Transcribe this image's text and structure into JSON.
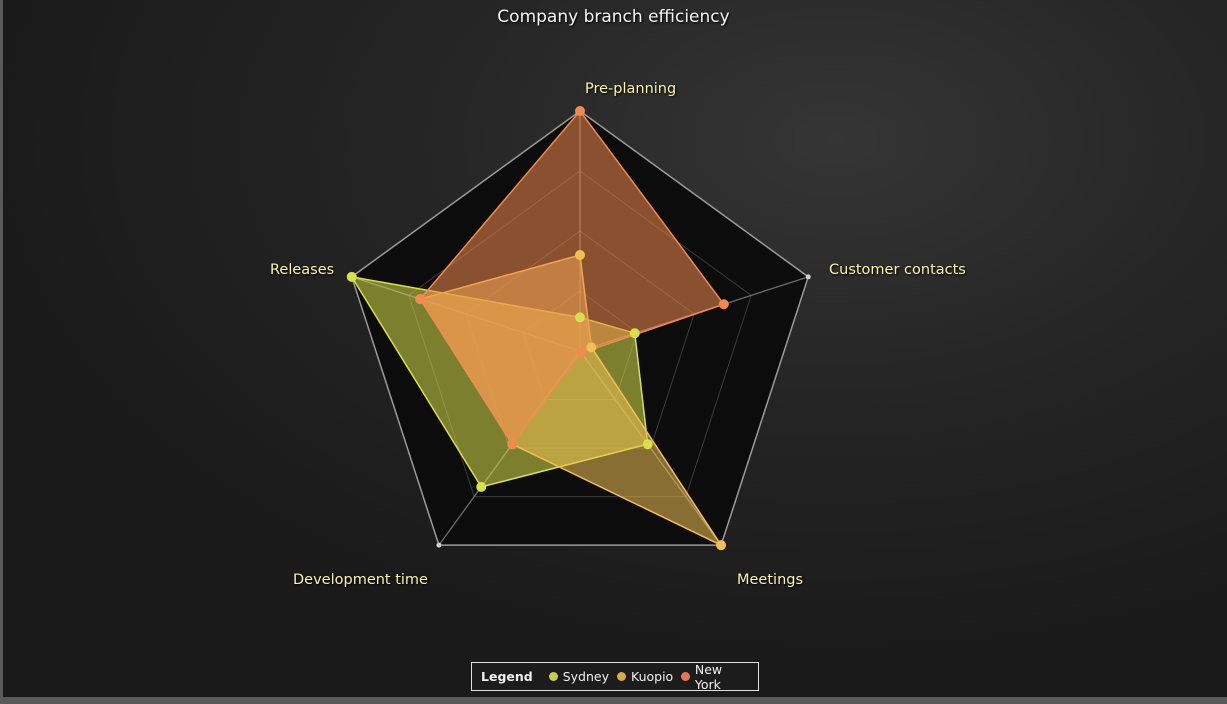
{
  "chart_data": {
    "type": "radar",
    "title": "Company branch efficiency",
    "axes": [
      "Pre-planning",
      "Customer contacts",
      "Meetings",
      "Development time",
      "Releases"
    ],
    "range": [
      0,
      100
    ],
    "rings": 4,
    "series": [
      {
        "name": "Sydney",
        "color": "#d8e04a",
        "values": [
          14,
          24,
          48,
          70,
          100
        ]
      },
      {
        "name": "Kuopio",
        "color": "#f0c054",
        "values": [
          40,
          5,
          100,
          48,
          70
        ]
      },
      {
        "name": "New York",
        "color": "#f08a4f",
        "values": [
          100,
          63,
          1,
          48,
          70
        ]
      }
    ],
    "legend": {
      "title": "Legend",
      "position": "bottom-center"
    }
  }
}
